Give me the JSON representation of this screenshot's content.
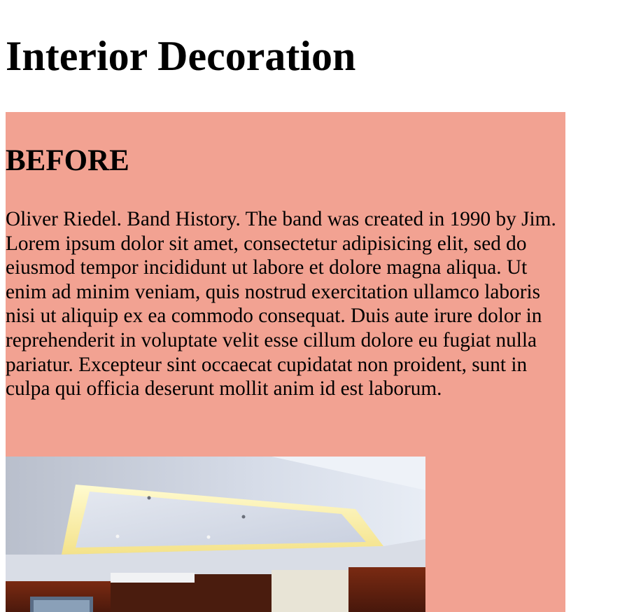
{
  "page": {
    "title": "Interior Decoration"
  },
  "before_section": {
    "heading": "BEFORE",
    "body": "Oliver Riedel. Band History. The band was created in 1990 by Jim. Lorem ipsum dolor sit amet, consectetur adipisicing elit, sed do eiusmod tempor incididunt ut labore et dolore magna aliqua. Ut enim ad minim veniam, quis nostrud exercitation ullamco laboris nisi ut aliquip ex ea commodo consequat. Duis aute irure dolor in reprehenderit in voluptate velit esse cillum dolore eu fugiat nulla pariatur. Excepteur sint occaecat cupidatat non proident, sunt in culpa qui officia deserunt mollit anim id est laborum.",
    "background_color": "#f2a292"
  }
}
